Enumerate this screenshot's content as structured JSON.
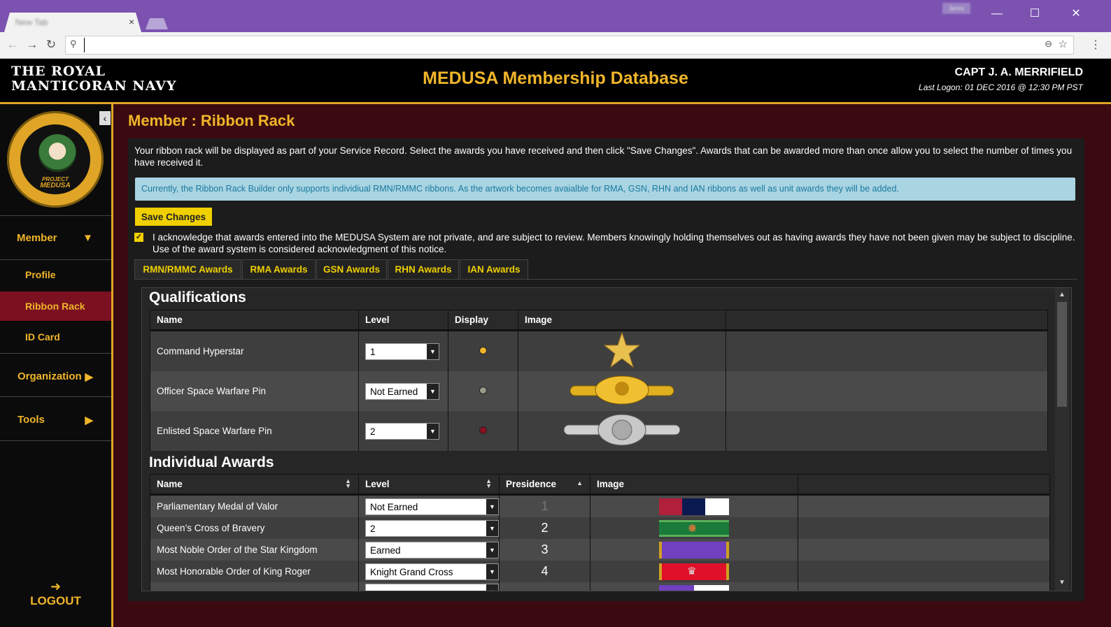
{
  "browser": {
    "tab_title": "New Tab",
    "tab_close": "×",
    "user_badge": "Jenni",
    "url": "",
    "controls": {
      "minimize": "—",
      "maximize": "☐",
      "close": "✕"
    }
  },
  "header": {
    "logo_line1": "THE ROYAL",
    "logo_line2": "MANTICORAN NAVY",
    "app_title": "MEDUSA Membership Database",
    "user_name": "CAPT J. A. MERRIFIELD",
    "last_logon": "Last Logon: 01 DEC 2016 @ 12:30 PM PST"
  },
  "sidebar": {
    "seal_text_line1": "PROJECT",
    "seal_text_line2": "MEDUSA",
    "seal_ring_text": "Manticoran Enhanced Data Usability Service Architecture",
    "member_label": "Member",
    "items": [
      {
        "label": "Profile"
      },
      {
        "label": "Ribbon Rack"
      },
      {
        "label": "ID Card"
      }
    ],
    "organization_label": "Organization",
    "tools_label": "Tools",
    "logout_label": "LOGOUT"
  },
  "main": {
    "page_title": "Member : Ribbon Rack",
    "intro": "Your ribbon rack will be displayed as part of your Service Record. Select the awards you have received and then click \"Save Changes\". Awards that can be awarded more than once allow you to select the number of times you have received it.",
    "alert": "Currently, the Ribbon Rack Builder only supports individiual RMN/RMMC ribbons. As the artwork becomes avaialble for RMA, GSN, RHN and IAN ribbons as well as unit awards they will be added.",
    "save_label": "Save Changes",
    "ack_checked": true,
    "acknowledgment": "I acknowledge that awards entered into the MEDUSA System are not private, and are subject to review. Members knowingly holding themselves out as having awards they have not been given may be subject to discipline. Use of the award system is considered acknowledgment of this notice.",
    "tabs": [
      {
        "label": "RMN/RMMC Awards"
      },
      {
        "label": "RMA Awards"
      },
      {
        "label": "GSN Awards"
      },
      {
        "label": "RHN Awards"
      },
      {
        "label": "IAN Awards"
      }
    ]
  },
  "qualifications": {
    "title": "Qualifications",
    "columns": {
      "name": "Name",
      "level": "Level",
      "display": "Display",
      "image": "Image"
    },
    "rows": [
      {
        "name": "Command Hyperstar",
        "level": "1",
        "display_color": "#f0b52a",
        "image": "gold-star-icon"
      },
      {
        "name": "Officer Space Warfare Pin",
        "level": "Not Earned",
        "display_color": "#9a9a8a",
        "image": "gold-warfare-pin"
      },
      {
        "name": "Enlisted Space Warfare Pin",
        "level": "2",
        "display_color": "#8a1020",
        "image": "silver-warfare-pin"
      }
    ]
  },
  "individual_awards": {
    "title": "Individual Awards",
    "columns": {
      "name": "Name",
      "level": "Level",
      "precedence": "Presidence",
      "image": "Image"
    },
    "rows": [
      {
        "name": "Parliamentary Medal of Valor",
        "level": "Not Earned",
        "precedence": "1",
        "ribbon_colors": [
          "#b0203a",
          "#0a1a50",
          "#ffffff"
        ]
      },
      {
        "name": "Queen’s Cross of Bravery",
        "level": "2",
        "precedence": "2",
        "ribbon_colors": [
          "#1a7a3a",
          "#1a7a3a",
          "#1a7a3a"
        ]
      },
      {
        "name": "Most Noble Order of the Star Kingdom",
        "level": "Earned",
        "precedence": "3",
        "ribbon_colors": [
          "#7040c0",
          "#7040c0",
          "#7040c0"
        ]
      },
      {
        "name": "Most Honorable Order of King Roger",
        "level": "Knight Grand Cross",
        "precedence": "4",
        "ribbon_colors": [
          "#e0102a",
          "#e0102a",
          "#e0102a"
        ]
      }
    ]
  }
}
